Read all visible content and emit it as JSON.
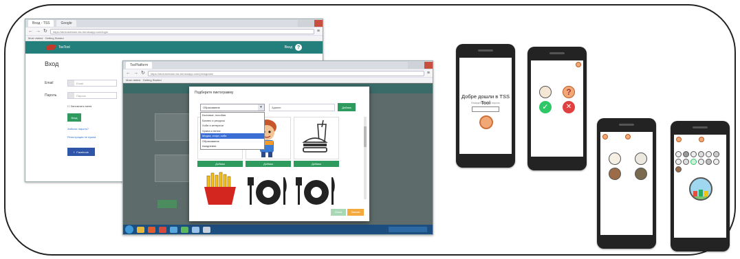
{
  "browser_login": {
    "tabs": [
      "Вход - TSS",
      "Google"
    ],
    "url": "https://devtutorteam-tss.herokuapp.com/login",
    "bookmarks": "Most visited  ·  Getting Started",
    "app_name": "TssTool",
    "header_user": "Вход",
    "heading": "Вход",
    "email_label": "Email",
    "email_placeholder": "Email",
    "password_label": "Пароль",
    "password_placeholder": "Пароль",
    "remember": "Запомнить меня",
    "login_btn": "Вход",
    "forgot_link": "Забыли пароль?",
    "register_link": "Регистрация не нужна",
    "facebook_btn": "Facebook"
  },
  "browser_picto": {
    "tabs": [
      "TssPlatform"
    ],
    "url": "https://devtutorteam-tss.herokuapp.com/pictograms",
    "modal_title": "Подберите пиктограмму",
    "select_value": "Образование",
    "search_value": "Здание",
    "search_btn": "Добавь",
    "dropdown_options": [
      "Бытовые, пособия",
      "Бизнес и ресурсы",
      "Хоби и интереси",
      "Храна и питие",
      "Медиа, спорт, хоби",
      "Образование",
      "ежедневни"
    ],
    "dropdown_selected": 4,
    "card_btn": "Добави",
    "footer_btn_a": "Отказ",
    "footer_btn_b": "Запази"
  },
  "phone1": {
    "title": "Добре дошли в TSS Tool",
    "subtitle": "Въведете вашата парола",
    "accent": "#f0a877"
  },
  "phone2": {
    "question_glyph": "?",
    "check_glyph": "✓",
    "cross_glyph": "✕"
  },
  "colors": {
    "teal": "#237f7c",
    "green": "#2e9a5e",
    "red": "#e0403f",
    "orange": "#f0a877"
  }
}
